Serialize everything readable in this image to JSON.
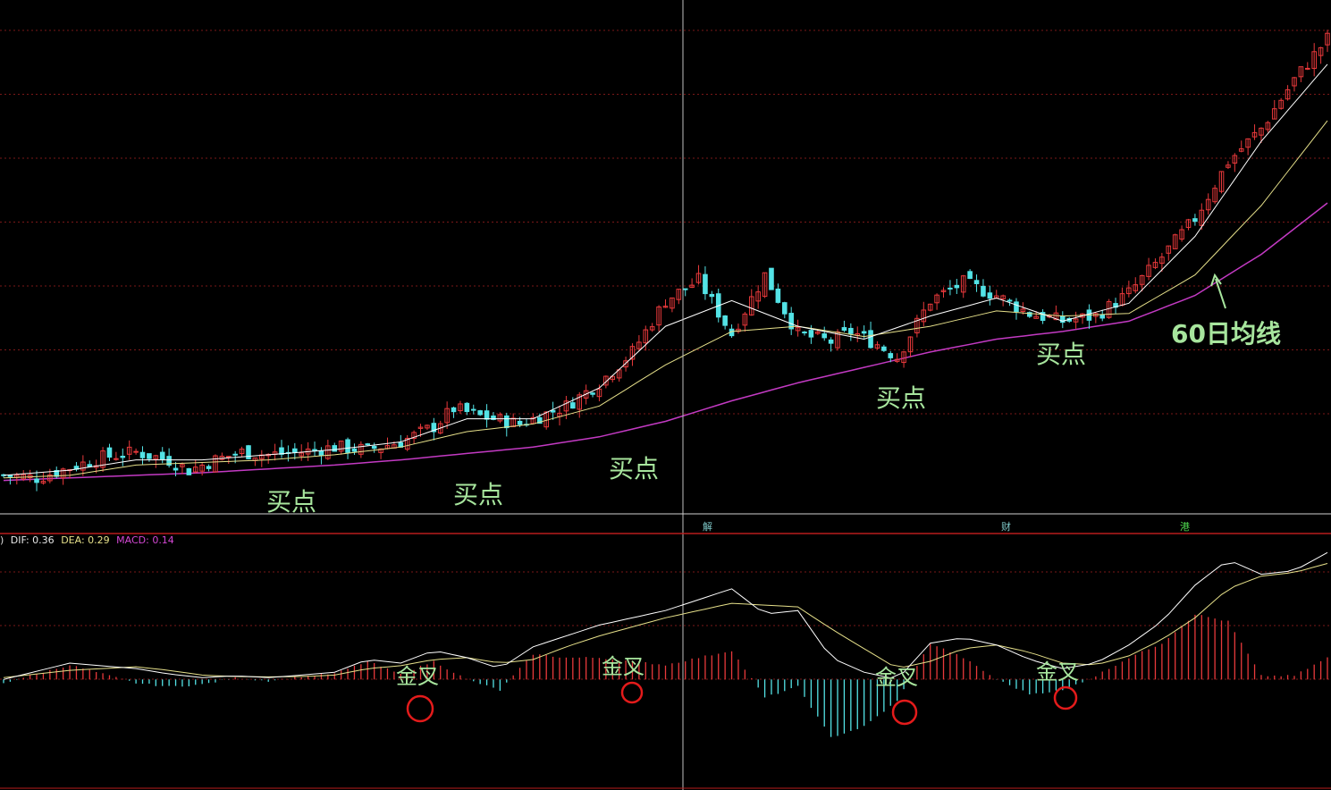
{
  "colors": {
    "background": "#000000",
    "grid": "#7a1818",
    "divider": "#b81c1c",
    "up_candle": "#e8393b",
    "down_candle": "#53e3e6",
    "ma_short": "#ffffff",
    "ma_mid": "#e6e08a",
    "ma60": "#c33ac3",
    "annotation": "#a7e59d",
    "circle": "#e31b1b",
    "macd_pos": "#e8393b",
    "macd_neg": "#53e3e6"
  },
  "indicator_bar": {
    "prefix": ")",
    "dif": "DIF: 0.36",
    "dea": "DEA: 0.29",
    "macd": "MACD: 0.14"
  },
  "axis_markers": [
    "解",
    "财",
    "港"
  ],
  "annotations": {
    "buy_points": [
      "买点",
      "买点",
      "买点",
      "买点",
      "买点"
    ],
    "ma60_label": "60日均线",
    "golden_cross": [
      "金叉",
      "金叉",
      "金叉",
      "金叉"
    ]
  },
  "chart_data": [
    {
      "type": "candlestick",
      "title": "",
      "series": [
        {
          "name": "",
          "kind": "price_close_path",
          "x": [
            0,
            5,
            10,
            15,
            20,
            25,
            28,
            32,
            36,
            40,
            45,
            50,
            55,
            60,
            65,
            68,
            72,
            78,
            85,
            90,
            95,
            100,
            105,
            110,
            115,
            120,
            125,
            128,
            132,
            135,
            140,
            145,
            150,
            155,
            160,
            165,
            170,
            175,
            180,
            185,
            190,
            195,
            200
          ],
          "close": [
            10.0,
            9.9,
            10.3,
            10.7,
            10.9,
            10.6,
            10.2,
            10.6,
            10.9,
            10.8,
            10.9,
            11.1,
            11.0,
            11.3,
            11.9,
            12.6,
            12.3,
            12.0,
            12.7,
            13.6,
            14.8,
            16.8,
            17.6,
            15.5,
            17.8,
            15.5,
            15.2,
            15.6,
            15.1,
            14.6,
            16.8,
            17.5,
            17.0,
            16.3,
            16.0,
            16.2,
            17.1,
            18.5,
            20.0,
            22.2,
            23.5,
            25.4,
            27.0
          ]
        },
        {
          "name": "",
          "kind": "ma_short",
          "x": [
            0,
            10,
            20,
            30,
            40,
            50,
            60,
            70,
            80,
            90,
            100,
            110,
            120,
            130,
            140,
            150,
            160,
            170,
            180,
            190,
            200
          ],
          "y": [
            10.0,
            10.2,
            10.6,
            10.6,
            10.8,
            11.0,
            11.3,
            12.2,
            12.2,
            13.4,
            15.8,
            16.8,
            15.8,
            15.3,
            16.2,
            16.9,
            16.0,
            16.7,
            19.3,
            23.0,
            26.0
          ]
        },
        {
          "name": "",
          "kind": "ma_mid",
          "x": [
            0,
            10,
            20,
            30,
            40,
            50,
            60,
            70,
            80,
            90,
            100,
            110,
            120,
            130,
            140,
            150,
            160,
            170,
            180,
            190,
            200
          ],
          "y": [
            9.9,
            10.0,
            10.4,
            10.5,
            10.6,
            10.8,
            11.1,
            11.7,
            12.0,
            12.7,
            14.3,
            15.6,
            15.8,
            15.4,
            15.8,
            16.4,
            16.2,
            16.3,
            17.8,
            20.5,
            23.8
          ]
        },
        {
          "name": "60日均线",
          "kind": "ma60",
          "x": [
            0,
            10,
            20,
            30,
            40,
            50,
            60,
            70,
            80,
            90,
            100,
            110,
            120,
            130,
            140,
            150,
            160,
            170,
            180,
            190,
            200
          ],
          "y": [
            9.8,
            9.9,
            10.0,
            10.1,
            10.25,
            10.4,
            10.6,
            10.85,
            11.1,
            11.5,
            12.1,
            12.9,
            13.6,
            14.2,
            14.8,
            15.3,
            15.6,
            16.0,
            17.0,
            18.6,
            20.6
          ]
        }
      ],
      "ylim": [
        8.5,
        28.5
      ]
    },
    {
      "type": "macd",
      "title": "",
      "series": [
        {
          "name": "DIF",
          "x": [
            0,
            10,
            20,
            25,
            30,
            35,
            40,
            45,
            50,
            55,
            60,
            65,
            70,
            75,
            80,
            85,
            90,
            95,
            100,
            105,
            110,
            115,
            120,
            125,
            130,
            135,
            140,
            145,
            150,
            155,
            160,
            165,
            170,
            175,
            180,
            185,
            190,
            195,
            200
          ],
          "y": [
            0.0,
            0.45,
            0.3,
            0.15,
            0.05,
            0.1,
            0.05,
            0.12,
            0.2,
            0.55,
            0.45,
            0.8,
            0.6,
            0.3,
            0.9,
            1.2,
            1.5,
            1.7,
            1.9,
            2.2,
            2.5,
            1.8,
            1.9,
            0.6,
            0.2,
            0.0,
            1.0,
            1.15,
            0.95,
            0.55,
            0.3,
            0.45,
            0.95,
            1.6,
            2.6,
            3.3,
            2.9,
            3.0,
            3.5
          ]
        },
        {
          "name": "DEA",
          "x": [
            0,
            10,
            20,
            25,
            30,
            35,
            40,
            45,
            50,
            55,
            60,
            65,
            70,
            75,
            80,
            85,
            90,
            95,
            100,
            105,
            110,
            115,
            120,
            125,
            130,
            135,
            140,
            145,
            150,
            155,
            160,
            165,
            170,
            175,
            180,
            185,
            190,
            195,
            200
          ],
          "y": [
            0.05,
            0.25,
            0.35,
            0.25,
            0.12,
            0.08,
            0.07,
            0.08,
            0.12,
            0.3,
            0.38,
            0.55,
            0.6,
            0.45,
            0.55,
            0.9,
            1.2,
            1.45,
            1.7,
            1.9,
            2.1,
            2.05,
            2.0,
            1.4,
            0.85,
            0.3,
            0.5,
            0.85,
            0.95,
            0.75,
            0.45,
            0.4,
            0.65,
            1.1,
            1.7,
            2.5,
            2.85,
            2.95,
            3.2
          ]
        }
      ],
      "ylim": [
        -3.0,
        4.0
      ]
    }
  ]
}
